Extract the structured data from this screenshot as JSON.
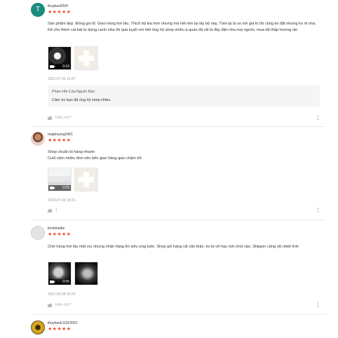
{
  "reviews": [
    {
      "avatar_letter": "T",
      "username": "thuybao0204",
      "stars": "★★★★★",
      "text": "Sản phẩm đẹp. Đóng gói kĩ. Giao hàng hơi lâu. Thích bộ kia hơn nhưng mà hết nên lại lấy bộ này. Tóm lại là so với giá trị thì cũng ko đắt nhưng ko rẻ nha. Kể cho thêm cái bát to đựng canh nữa thì quá tuyệt vời hihi ủng hộ shop nhiều à quán đã rất là đầy đặn nha mọi người, mua tất thấp hương oki",
      "video_duration": "0:16",
      "date": "2022-07-05 12:37",
      "reply_title": "Phản Hồi Của Người Bán",
      "reply_text": "Cảm ơn bạn đã ủng hộ shop nhiều.",
      "like_label": "Hữu ích?"
    },
    {
      "username": "maiphuong2401",
      "stars": "★★★★★",
      "text_line1": "Shop chuẩn bị hàng nhanh",
      "text_line2": "Cuối năm nhiều đơn nên bên giao hàng giao chậm trễ",
      "video_duration": "0:05",
      "date": "2022-07-09 18:31",
      "like_label": "1"
    },
    {
      "username": "timinhtelbe",
      "stars": "★★★★★",
      "text": "Chờ hàng hơi lâu một xíu nhưng nhận hàng thì siêu ưng luôn. Shop gói hàng rất cẩn thận, ko bị vỡ hay nứt chút nào. Shipper cũng rất nhiệt tình",
      "video_duration": "0:05",
      "date": "2021-09-28 16:24",
      "like_label": "Hữu ích?"
    },
    {
      "username": "thuyhanh11022001",
      "stars": "★★★★★"
    }
  ]
}
